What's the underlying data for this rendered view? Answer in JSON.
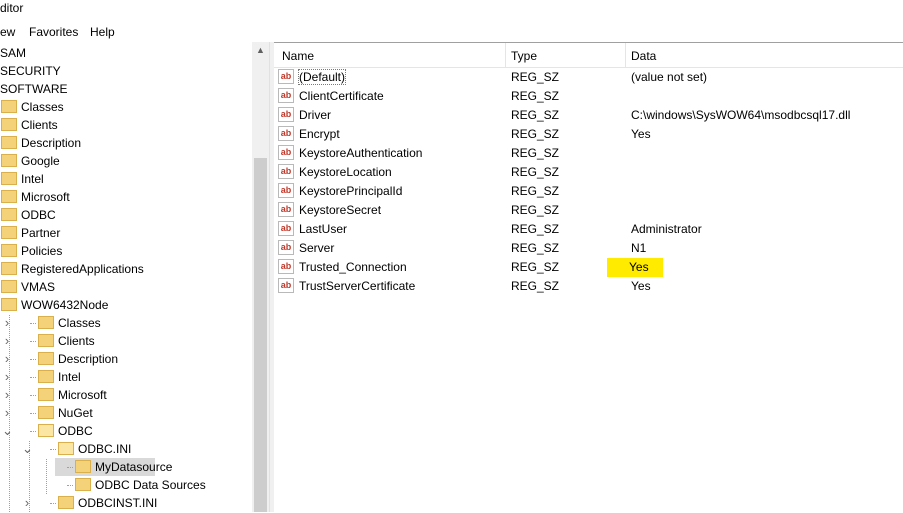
{
  "title": "ditor",
  "menu": [
    "ew",
    "Favorites",
    "Help"
  ],
  "tree": [
    {
      "label": "SAM",
      "indent": 0,
      "folder": false
    },
    {
      "label": "SECURITY",
      "indent": 0,
      "folder": false
    },
    {
      "label": "SOFTWARE",
      "indent": 0,
      "folder": false
    },
    {
      "label": "Classes",
      "indent": 1,
      "folder": true
    },
    {
      "label": "Clients",
      "indent": 1,
      "folder": true
    },
    {
      "label": "Description",
      "indent": 1,
      "folder": true
    },
    {
      "label": "Google",
      "indent": 1,
      "folder": true
    },
    {
      "label": "Intel",
      "indent": 1,
      "folder": true
    },
    {
      "label": "Microsoft",
      "indent": 1,
      "folder": true
    },
    {
      "label": "ODBC",
      "indent": 1,
      "folder": true
    },
    {
      "label": "Partner",
      "indent": 1,
      "folder": true
    },
    {
      "label": "Policies",
      "indent": 1,
      "folder": true
    },
    {
      "label": "RegisteredApplications",
      "indent": 1,
      "folder": true
    },
    {
      "label": "VMAS",
      "indent": 1,
      "folder": true
    },
    {
      "label": "WOW6432Node",
      "indent": 1,
      "folder": true
    },
    {
      "label": "Classes",
      "indent": 2,
      "folder": true,
      "chev": ">"
    },
    {
      "label": "Clients",
      "indent": 2,
      "folder": true,
      "chev": ">"
    },
    {
      "label": "Description",
      "indent": 2,
      "folder": true,
      "chev": ">"
    },
    {
      "label": "Intel",
      "indent": 2,
      "folder": true,
      "chev": ">"
    },
    {
      "label": "Microsoft",
      "indent": 2,
      "folder": true,
      "chev": ">"
    },
    {
      "label": "NuGet",
      "indent": 2,
      "folder": true,
      "chev": ">"
    },
    {
      "label": "ODBC",
      "indent": 2,
      "folder": true,
      "chev": "v"
    },
    {
      "label": "ODBC.INI",
      "indent": 3,
      "folder": true,
      "chev": "v"
    },
    {
      "label": "MyDatasource",
      "indent": 4,
      "folder": true,
      "selected": true
    },
    {
      "label": "ODBC Data Sources",
      "indent": 4,
      "folder": true
    },
    {
      "label": "ODBCINST.INI",
      "indent": 3,
      "folder": true,
      "chev": ">"
    }
  ],
  "columns": [
    "Name",
    "Type",
    "Data"
  ],
  "rows": [
    {
      "name": "(Default)",
      "type": "REG_SZ",
      "data": "(value not set)"
    },
    {
      "name": "ClientCertificate",
      "type": "REG_SZ",
      "data": ""
    },
    {
      "name": "Driver",
      "type": "REG_SZ",
      "data": "C:\\windows\\SysWOW64\\msodbcsql17.dll"
    },
    {
      "name": "Encrypt",
      "type": "REG_SZ",
      "data": "Yes"
    },
    {
      "name": "KeystoreAuthentication",
      "type": "REG_SZ",
      "data": ""
    },
    {
      "name": "KeystoreLocation",
      "type": "REG_SZ",
      "data": ""
    },
    {
      "name": "KeystorePrincipalId",
      "type": "REG_SZ",
      "data": ""
    },
    {
      "name": "KeystoreSecret",
      "type": "REG_SZ",
      "data": ""
    },
    {
      "name": "LastUser",
      "type": "REG_SZ",
      "data": "Administrator"
    },
    {
      "name": "Server",
      "type": "REG_SZ",
      "data": "N1"
    },
    {
      "name": "Trusted_Connection",
      "type": "REG_SZ",
      "data": "Yes",
      "highlight": true
    },
    {
      "name": "TrustServerCertificate",
      "type": "REG_SZ",
      "data": "Yes"
    }
  ],
  "icons": {
    "value": "string-value-ab-icon",
    "folder": "folder-icon"
  },
  "icon_glyph": "ab",
  "colors": {
    "highlight": "#ffeb00",
    "folder": "#f4d27a",
    "selected": "#d9d9d9"
  }
}
